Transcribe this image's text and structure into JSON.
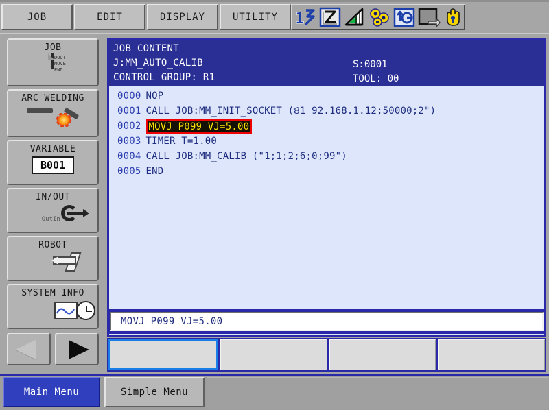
{
  "menubar": {
    "tabs": [
      {
        "label": "JOB",
        "name": "menu-tab-job"
      },
      {
        "label": "EDIT",
        "name": "menu-tab-edit"
      },
      {
        "label": "DISPLAY",
        "name": "menu-tab-display"
      },
      {
        "label": "UTILITY",
        "name": "menu-tab-utility"
      }
    ],
    "icons": [
      {
        "name": "step-number-icon",
        "title": "1"
      },
      {
        "name": "robot-coordinate-icon",
        "title": "Z"
      },
      {
        "name": "speed-level-icon",
        "title": "speed"
      },
      {
        "name": "gears-tool-icon",
        "title": "tool"
      },
      {
        "name": "camera-monitor-icon",
        "title": "camera"
      },
      {
        "name": "window-arrow-icon",
        "title": "window"
      },
      {
        "name": "hand-cursor-icon",
        "title": "hand"
      }
    ]
  },
  "sidebar": {
    "items": [
      {
        "label": "JOB",
        "icon": "job-document-icon",
        "icon_lines": "DOUT\nMOVE\nEND"
      },
      {
        "label": "ARC WELDING",
        "icon": "arc-welding-torch-icon"
      },
      {
        "label": "VARIABLE",
        "icon": "variable-box-icon",
        "value": "B001"
      },
      {
        "label": "IN/OUT",
        "icon": "in-out-icon",
        "in_label": "In",
        "out_label": "Out"
      },
      {
        "label": "ROBOT",
        "icon": "robot-arm-icon"
      },
      {
        "label": "SYSTEM INFO",
        "icon": "system-info-icon"
      }
    ],
    "prev_arrow": "prev-page-arrow",
    "next_arrow": "next-page-arrow"
  },
  "job_header": {
    "title": "JOB CONTENT",
    "job_name": "J:MM_AUTO_CALIB",
    "control_group": "CONTROL GROUP: R1",
    "step": "S:0001",
    "tool": "TOOL: 00"
  },
  "program": {
    "lines": [
      {
        "num": "0000",
        "text": "NOP",
        "selected": false
      },
      {
        "num": "0001",
        "text": "CALL JOB:MM_INIT_SOCKET (Ȣ1 92.168.1.12;50000;2\")",
        "selected": false
      },
      {
        "num": "0002",
        "text": "MOVJ P099 VJ=5.00",
        "selected": true
      },
      {
        "num": "0003",
        "text": "TIMER T=1.00",
        "selected": false
      },
      {
        "num": "0004",
        "text": "CALL JOB:MM_CALIB (\"1;1;2;6;0;99\")",
        "selected": false
      },
      {
        "num": "0005",
        "text": "END",
        "selected": false
      }
    ]
  },
  "edit_bar": {
    "value": "MOVJ P099 VJ=5.00"
  },
  "function_keys": [
    {
      "label": "",
      "active": true
    },
    {
      "label": "",
      "active": false
    },
    {
      "label": "",
      "active": false
    },
    {
      "label": "",
      "active": false
    }
  ],
  "bottom_tabs": {
    "main": "Main Menu",
    "simple": "Simple Menu"
  },
  "colors": {
    "header_blue": "#2a2f95",
    "panel_frame": "#2a2aa8",
    "content_bg": "#dde6fa",
    "line_text": "#1f2d80",
    "highlight_bg": "#141002",
    "highlight_text": "#ffe000",
    "highlight_border": "#ee0000",
    "tab_active": "#2f3fbe",
    "chrome_gray": "#a6a6a6"
  }
}
